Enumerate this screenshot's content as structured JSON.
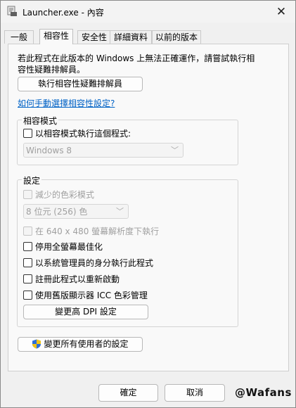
{
  "window": {
    "title": "Launcher.exe - 內容"
  },
  "tabs": [
    {
      "label": "一般"
    },
    {
      "label": "相容性"
    },
    {
      "label": "安全性"
    },
    {
      "label": "詳細資料"
    },
    {
      "label": "以前的版本"
    }
  ],
  "compat": {
    "description": "若此程式在此版本的 Windows 上無法正確運作，請嘗試執行相容性疑難排解員。",
    "troubleshooter_label": "執行相容性疑難排解員",
    "manual_link": "如何手動選擇相容性設定?"
  },
  "mode_group": {
    "title": "相容模式",
    "checkbox_label": "以相容模式執行這個程式:",
    "os_value": "Windows 8"
  },
  "settings_group": {
    "title": "設定",
    "reduced_color_label": "減少的色彩模式",
    "color_value": "8 位元 (256) 色",
    "res_640_label": "在 640 x 480 螢幕解析度下執行",
    "fullscreen_opt_label": "停用全螢幕最佳化",
    "admin_label": "以系統管理員的身分執行此程式",
    "register_restart_label": "註冊此程式以重新啟動",
    "legacy_icc_label": "使用舊版顯示器 ICC 色彩管理",
    "high_dpi_label": "變更高 DPI 設定"
  },
  "all_users_label": "變更所有使用者的設定",
  "footer": {
    "ok_label": "確定",
    "cancel_label": "取消"
  },
  "watermark": "@Wafans",
  "icons": [
    "app-icon",
    "close-icon",
    "chevron-down-icon",
    "shield-icon"
  ]
}
